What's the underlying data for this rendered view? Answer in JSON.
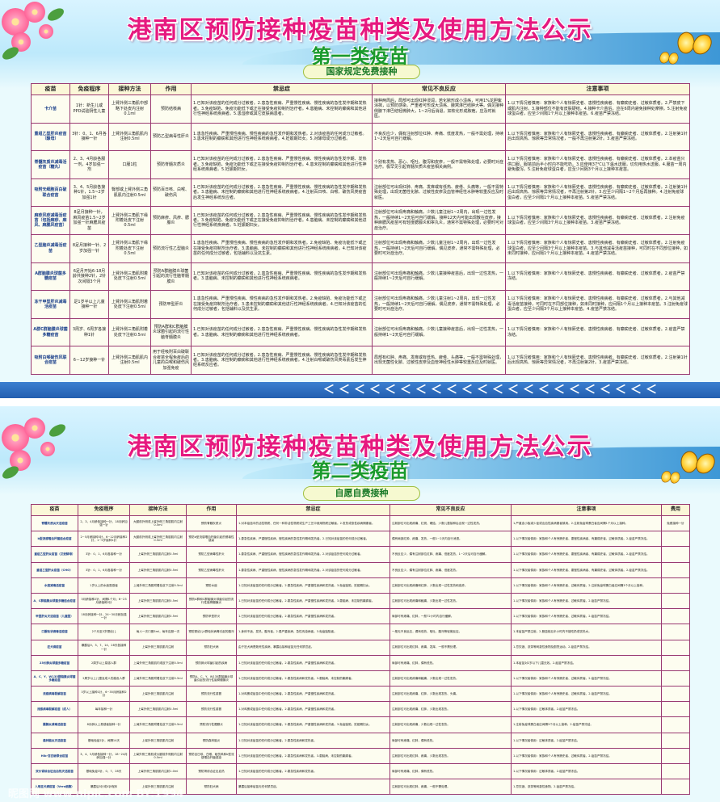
{
  "panel1": {
    "title": "港南区预防接种疫苗种类及使用方法公示",
    "subtitle": "第一类疫苗",
    "pill": "国家规定免费接种",
    "headers": [
      "疫苗",
      "免疫程序",
      "接种方法",
      "作用",
      "禁忌症",
      "常见不良反应",
      "注意事项"
    ],
    "rows": [
      [
        "卡介苗",
        "1针：新生儿或PPD试验阴性儿童",
        "上臂外侧三角肌中部略下处皮内注射0.1ml",
        "预防结核病",
        "1.已知对该疫苗的任何成分过敏者。2.患急性疾病、严重慢性疾病、慢性疾病的急性发作期和发热者。3.免疫缺陷、免疫功能低下或正在接受免疫抑制剂治疗者。4.患脑病、未控制的癫痫和其他进行性神经系统疾病者。5.患湿疹或其它皮肤病患者。",
        "接种两周后，局部可出现红肿浸润，若化脓形成小溃疡，可用1%龙胆紫涂抹，以预防感染。严重者可形成大溃疡、腋窝淋巴结肿大等。偶见接种侧腋下淋巴结轻微肿大，1~2月后消退，如软化形成脓疱，应及时就医。",
        "1.以下情况者慎用：家族和个人有惊厥史者、患慢性疾病者、有癫痫史者、过敏体质者。2.严禁皮下或肌内注射。3.接种部位不能有皮肤硬结。4.接种卡介苗后，应在6周内避免接种处摩擦。5.注射免疫球蛋白者，应至少间隔1个月以上接种本疫苗。6.疫苗严禁冻结。"
      ],
      [
        "重组乙型肝炎疫苗（酿母）",
        "3针：0、1、6月各接种一针",
        "上臂外侧三角肌肌内注射0.5ml",
        "预防乙型病毒性肝炎",
        "1.患急性疾病、严重慢性疾病、慢性疾病的急性发作期和发热者。2.对该疫苗的任何成分过敏者。3.患未控制的癫痫和其他进行性神经系统疾病者。4.妊娠期妇女。5.对酵母成分过敏者。",
        "不良反应少，偶有注射部位红肿、疼痛、低度发热，一般不需处理，持续1~2天后可自行缓解。",
        "1.以下情况者慎用：家族和个人有惊厥史者、患慢性疾病者、有癫痫史者、过敏体质者。2.注射第1针后出现高热、惊厥等异常情况者，一般不再注射第2针。3.疫苗严禁冻结。"
      ],
      [
        "脊髓灰质炎减毒活疫苗（糖丸）",
        "2、3、4月龄各服一剂，4岁加强一剂",
        "口服1粒",
        "预防脊髓灰质炎",
        "1.已知对该疫苗的任何成分过敏者。2.患急性疾病、严重慢性疾病、慢性疾病的急性发作期、发热者。3.免疫缺陷、免疫功能低下或正在接受免疫抑制剂治疗者。4.患未控制的癫痫和其他进行性神经系统疾病者。5.妊娠期妇女。",
        "个别有发热、恶心、呕吐、腹泻和皮疹，一般不需特殊处理，必要时对症治疗。极罕见引起脊髓灰质炎疫苗相关病例。",
        "1.以下情况者慎用：家族和个人有惊厥史者、患慢性疾病者、有癫痫史者、过敏体质者。2.本疫苗只供口服，服苗前后半小时内不能吃奶。3.应使用37℃以下温水送服，切勿用热水送服。4.服苗一周内避免腹泻。5.注射免疫球蛋白者，应至少间隔3个月以上接种本疫苗。"
      ],
      [
        "吸附无细胞百白破联合疫苗",
        "3、4、5月龄各接种1针，1.5~2岁加强1针",
        "臀部或上臂外侧三角肌肌内注射0.5ml",
        "预防百日咳、白喉、破伤风",
        "1.已知对该疫苗的任何成分过敏者。2.患急性疾病、严重慢性疾病、慢性疾病的急性发作期和发热者。3.患脑病、未控制的癫痫和其他进行性神经系统疾病者。4.注射百日咳、白喉、破伤风类疫苗后发生神经系统反应者。",
        "注射部位可出现红肿、疼痛、发痒或有低热、疲倦、头痛等，一般不需特殊处理，出现无菌性化脓、过敏性皮疹及血管神经性水肿等较重反应及时就医。",
        "1.以下情况者慎用：家族和个人有惊厥史者、患慢性疾病者、有癫痫史者、过敏体质者。2.注射第1针后出现高热、惊厥等异常情况者，不再注射第2针。3.应至少间隔1~2个月后再接种。4.注射免疫球蛋白者，应至少间隔1个月以上接种本疫苗。5.疫苗严禁冻结。"
      ],
      [
        "麻疹风疹减毒活疫苗（包括麻疹、麻风、麻腮风疫苗）",
        "8足月接种一针，麻风疫苗1.5~2岁加强一针麻腮风疫苗",
        "上臂外侧三角肌下缘附着处皮下注射0.5ml",
        "预防麻疹、风疹、腮腺炎",
        "1.已知对该疫苗的任何成分过敏者。2.患急性疾病、严重慢性疾病、慢性疾病的急性发作期和发热者。3.免疫缺陷、免疫功能低下或正在接受免疫抑制剂治疗者。4.患脑病、未控制的癫痫和其他进行性神经系统疾病者。5.妊娠期妇女。",
        "注射部位可出现疼痛和触痛，少数儿童注射1~2周内，出现一过性发热，一般持续1~2天后可自行缓解，接种12天内可能出现散在皮疹，接种麻腮风疫苗可有轻度腮腺炎和睾丸炎，通常不需特殊处理，必要时可对症治疗。",
        "1.以下情况者慎用：家族和个人有惊厥史者、患慢性疾病者、有癫痫史者、过敏体质者。2.注射免疫球蛋白者，应至少间隔3个月以上接种本疫苗。3.疫苗严禁冻结。"
      ],
      [
        "乙型脑炎减毒活疫苗",
        "8足月接种一针、2岁加强一针",
        "上臂外侧三角肌下缘附着处皮下注射0.5ml",
        "预防流行性乙型脑炎",
        "1.患急性疾病、严重慢性疾病、慢性疾病的急性发作期和发热者。2.免疫缺陷、免疫功能低下或正在接受免疫抑制剂治疗者。3.患脑病、未控制的癫痫和其他进行性神经系统疾病者。4.已知对该疫苗的任何成分过敏者，包括辅料以及抗生素。",
        "注射部位可出现疼痛和触痛，少数儿童注射1~2周内，出现一过性发热，一般持续1~2天后可自行缓解，偶见皮疹，通常不需特殊处理，必要时可对症治疗。",
        "1.以下情况者慎用：家族和个人有惊厥史者、患慢性疾病者、有癫痫史者、过敏体质者。2.注射免疫球蛋白者，应至少间隔3个月以上接种本疫苗。3.与其他减毒活疫苗接种，可同时在不同部位接种，如未同时接种，应间隔1个月以上接种本疫苗。4.疫苗严禁冻结。"
      ],
      [
        "A群脑膜炎球菌多糖疫苗",
        "6足月开始6-18月龄共接种2针，2针次间隔3个月",
        "上臂外侧三角肌附着处皮下注射0.5ml",
        "预防A群脑膜炎球菌引起的流行性脑脊髓膜炎",
        "1.已知对该疫苗的任何成分过敏者。2.患急性疾病、严重慢性疾病、慢性疾病的急性发作期和发热者。3.患脑病、未控制的癫痫和其他进行性神经系统疾病者。",
        "注射部位可出现疼痛和触痛，少数儿童接种疫苗后，出现一过性发热，一般持续1~2天后可自行缓解。",
        "1.以下情况者慎用：家族和个人有惊厥史者、患慢性疾病者、有癫痫史者、过敏体质者。2.疫苗严禁冻结。"
      ],
      [
        "冻干甲型肝炎减毒活疫苗",
        "足1岁半以上儿童接种一针",
        "上臂外侧三角肌附着处皮下注射0.5ml",
        "预防甲型肝炎",
        "1.患急性疾病、严重慢性疾病、慢性疾病的急性发作期和发热者。2.免疫缺陷、免疫功能低下或正在接受免疫抑制剂治疗者。3.患未控制的癫痫和其他进行性神经系统疾病者。4.已知对该疫苗的任何成分过敏者，包括辅料以及抗生素。",
        "注射部位可出现疼痛和触痛，少数儿童注射1~2周内，出现一过性发热，一般持续1~2天后可自行缓解，偶见皮疹，通常不需特殊处理，必要时可对症治疗。",
        "1.以下情况者慎用：家族和个人有惊厥史者、患慢性疾病者、有癫痫史者、过敏体质者。2.与其他减毒活疫苗接种，可同时在不同部位接种，如未同时接种，应间隔1个月以上接种本疫苗。3.注射免疫球蛋白者，应至少间隔3个月以上接种本疫苗。4.疫苗严禁冻结。"
      ],
      [
        "A群C群脑膜炎球菌多糖疫苗",
        "3周岁、6周岁各接种1针",
        "上臂外侧三角肌附着处皮下注射0.5ml",
        "预防A群和C群脑膜炎球菌引起的流行性脑脊髓膜炎",
        "1.已知对该疫苗的任何成分过敏者。2.患急性疾病、严重慢性疾病、慢性疾病的急性发作期和发热者。3.患脑病、未控制的癫痫和其他进行性神经系统疾病者。",
        "注射部位可出现疼痛和触痛，少数儿童接种疫苗后，出现一过性发热，一般持续1~2天后可自行缓解。",
        "1.以下情况者慎用：家族和个人有惊厥史者、患慢性疾病者、有癫痫史者、过敏体质者。2.疫苗严禁冻结。"
      ],
      [
        "吸附白喉破伤风联合疫苗",
        "6－12岁接种一针",
        "上臂外侧三角肌肌内注射0.5ml",
        "用于经吸附百白破联合疫苗全程免疫后的儿童的白喉和破伤风加强免疫",
        "1.已知对该疫苗的任何成分过敏者。2.患急性疾病、严重慢性疾病、慢性疾病的急性发作期和发热者。3.患脑病、未控制的癫痫和其他进行性神经系统疾病者。4.注射白喉或破伤风类毒素后发生神经系统反应者。",
        "局部有红肿、疼痛、发痒或有低热、疲倦、头痛等，一般不需特殊处理，出现无菌性化脓、过敏性皮疹及血管神经性水肿等较重反应及时就医。",
        "1.以下情况者慎用：家族和个人有惊厥史者、患慢性疾病者、有癫痫史者、过敏体质者。2.注射第1针后出现高热、惊厥等异常情况者，不再注射第2针。3.疫苗严禁冻结。"
      ]
    ]
  },
  "panel2": {
    "title": "港南区预防接种疫苗种类及使用方法公示",
    "subtitle": "第二类疫苗",
    "pill": "自愿自费接种",
    "headers": [
      "疫苗",
      "免疫程序",
      "接种方法",
      "作用",
      "禁忌症",
      "常见不良反应",
      "注意事项",
      "费用"
    ],
    "rows": [
      [
        "脊髓灰质炎灭活疫苗",
        "2、3、4月龄各接种一针，18月龄加强一针",
        "大腿前外侧或上臂外侧三角肌肌内注射0.5ml",
        "预防脊髓灰质炎",
        "1.对本疫苗中的活性物质、任何一种非活性物质或生产工艺中使用物质过敏者。2.发热或急性疾病期患者。",
        "注射部位可出现疼痛、红斑、硬结，少数儿童接种后出现一过性发热。",
        "1.严重血小板减少症或出血性疾病患者慎用。2.注射免疫球蛋白者应间隔1个月以上接种。",
        "免费接种一针"
      ],
      [
        "b型流感嗜血杆菌结合疫苗",
        "2~5月龄接种3针，6~12月龄接种2针，1~5岁接种1针",
        "大腿前外侧或上臂外侧三角肌肌内注射0.5ml",
        "预防b型流感嗜血杆菌引起的侵袭性感染",
        "1.患急性疾病、严重慢性疾病、慢性疾病的急性发作期和发热者。2.已知对该疫苗的任何成分过敏者。",
        "偶有局部红肿、疼痛、发热，一般1~2天内自行消退。",
        "1.以下情况者慎用：家族和个人有惊厥史者、患慢性疾病者、有癫痫史者、过敏体质者。2.疫苗严禁冻结。",
        ""
      ],
      [
        "重组乙型肝炎疫苗（汉逊酵母）",
        "3针：0、1、6月各接种一针",
        "上臂外侧三角肌肌内注射0.5ml",
        "预防乙型病毒性肝炎",
        "1.患急性疾病、严重慢性疾病、慢性疾病的急性发作期和发热者。2.对该疫苗的任何成分过敏者。",
        "不良反应少，偶有注射部位红肿、疼痛、低度发热，1~2天后可自行缓解。",
        "1.以下情况者慎用：家族和个人有惊厥史者、患慢性疾病者、有癫痫史者、过敏体质者。2.疫苗严禁冻结。",
        ""
      ],
      [
        "重组乙型肝炎疫苗（CHO）",
        "3针：0、1、6月各接种一针",
        "上臂外侧三角肌肌内注射0.5ml",
        "预防乙型病毒性肝炎",
        "1.患急性疾病、严重慢性疾病、慢性疾病的急性发作期和发热者。2.对该疫苗的任何成分过敏者。",
        "不良反应少，偶有注射部位红肿、疼痛、低度发热。",
        "1.以下情况者慎用：家族和个人有惊厥史者、患慢性疾病者、有癫痫史者、过敏体质者。2.疫苗严禁冻结。",
        ""
      ],
      [
        "水痘减毒活疫苗",
        "1岁以上的水痘易感者",
        "上臂外侧三角肌附着处皮下注射0.5ml",
        "预防水痘",
        "1.已知对该疫苗的任何成分过敏者。2.患急性疾病、严重慢性疾病和发热者。3.免疫缺陷、妊娠期妇女。",
        "注射部位可出现疼痛和红肿，少数出现一过性发热和皮疹。",
        "1.以下情况者慎用：家族和个人有惊厥史者、过敏体质者。2.注射免疫球蛋白者应间隔3个月以上接种。",
        ""
      ],
      [
        "A、C群脑膜炎球菌多糖结合疫苗",
        "3月龄接种2针，间隔1个月；6~23月龄接种2针",
        "上臂外侧三角肌肌内注射0.5ml",
        "预防A群和C群脑膜炎球菌引起的流行性脑脊髓膜炎",
        "1.已知对该疫苗的任何成分过敏者。2.患急性疾病、严重慢性疾病和发热者。3.患脑病、未控制的癫痫者。",
        "注射部位可出现疼痛和触痛，少数出现一过性发热。",
        "1.以下情况者慎用：家族和个人有惊厥史者、过敏体质者。2.疫苗严禁冻结。",
        ""
      ],
      [
        "甲型肝炎灭活疫苗（儿童型）",
        "18月龄接种一针，24~30月龄加强一针",
        "上臂外侧三角肌肌内注射0.5ml",
        "预防甲型肝炎",
        "1.已知对该疫苗的任何成分过敏者。2.患急性疾病、严重慢性疾病和发热者。",
        "局部可有疼痛、红肿，一般72小时内自行缓解。",
        "1.以下情况者慎用：家族和个人有惊厥史者、过敏体质者。2.疫苗严禁冻结。",
        ""
      ],
      [
        "口服轮状病毒活疫苗",
        "2个月至3岁婴幼儿",
        "每人一次口服3ml，每年应服一次",
        "预防婴幼儿A群轮状病毒引起的腹泻",
        "1.身体不适、发热、腹泻者。2.患严重疾病、急性传染病者。3.免疫缺陷者。",
        "一般无不良反应，偶有低热、呕吐、腹泻等轻微反应。",
        "1.本疫苗严禁注射。2.服苗前后半小时内不能吃奶或饮热水。",
        ""
      ],
      [
        "狂犬病疫苗",
        "暴露后0、3、7、14、28天各接种一针",
        "上臂外侧三角肌肌内注射",
        "预防狂犬病",
        "由于狂犬病是致死性疾病，暴露后接种疫苗无任何禁忌症。",
        "注射部位可出现红肿、疼痛、发痒，一般不需处理。",
        "1.忌饮酒、浓茶等刺激性食物及剧烈运动。2.疫苗严禁冻结。",
        ""
      ],
      [
        "23价肺炎球菌多糖疫苗",
        "2周岁以上易感人群",
        "上臂外侧三角肌肌内或皮下注射0.5ml",
        "预防肺炎球菌引起的疾病",
        "1.已知对该疫苗的任何成分过敏者。2.患急性疾病、严重慢性疾病和发热者。",
        "局部可有疼痛、红肿，偶有低热。",
        "1.本疫苗对2岁以下儿童无效。2.疫苗严禁冻结。",
        ""
      ],
      [
        "A、C、Y、W135群脑膜炎球菌多糖疫苗",
        "2周岁以上儿童及成人的高危人群",
        "上臂外侧三角肌附着处皮下注射0.5ml",
        "预防A、C、Y、W135群脑膜炎球菌引起的流行性脑脊髓膜炎",
        "1.已知对该疫苗的任何成分过敏者。2.患急性疾病和发热者。3.患脑病、未控制的癫痫者。",
        "注射部位可出现疼痛和触痛，少数出现一过性发热。",
        "1.以下情况者慎用：家族和个人有惊厥史者、过敏体质者。2.疫苗严禁冻结。",
        ""
      ],
      [
        "流感病毒裂解疫苗",
        "3岁以上接种1针，6~35月龄接种2针",
        "上臂外侧三角肌肌内注射",
        "预防流行性感冒",
        "1.对鸡蛋或疫苗中任何成分过敏者。2.患急性疾病、严重慢性疾病和发热者。",
        "注射部位可出现疼痛、红肿，少数出现发热、头痛。",
        "1.以下情况者慎用：家族和个人有惊厥史者、过敏体质者。2.疫苗严禁冻结。",
        ""
      ],
      [
        "流感病毒裂解疫苗（成人）",
        "每年接种一针",
        "上臂外侧三角肌肌内注射0.5ml",
        "预防流行性感冒",
        "1.对鸡蛋或疫苗中任何成分过敏者。2.患急性疾病、严重慢性疾病和发热者。",
        "注射部位可出现疼痛、红肿，少数出现发热。",
        "1.以下情况者慎用：过敏体质者。2.疫苗严禁冻结。",
        ""
      ],
      [
        "腮腺炎减毒活疫苗",
        "8月龄以上易感者接种一针",
        "上臂外侧三角肌附着处皮下注射0.5ml",
        "预防流行性腮腺炎",
        "1.已知对该疫苗的任何成分过敏者。2.患急性疾病、严重慢性疾病和发热者。3.免疫缺陷、妊娠期妇女。",
        "注射部位可出现疼痛，少数出现一过性发热。",
        "1.注射免疫球蛋白者应间隔3个月以上接种。2.疫苗严禁冻结。",
        ""
      ],
      [
        "森林脑炎灭活疫苗",
        "基础免疫2针，间隔14天",
        "上臂外侧三角肌肌内注射",
        "预防森林脑炎",
        "1.已知对该疫苗的任何成分过敏者。2.患急性疾病和发热者。",
        "局部可有疼痛、红肿，偶有低热。",
        "1.以下情况者慎用：过敏体质者。2.疫苗严禁冻结。",
        ""
      ],
      [
        "Hib-百白破联合疫苗",
        "3、4、5月龄各接种一针，18~24月龄加强一针",
        "上臂外侧三角肌或大腿前外侧肌内注射0.5ml",
        "预防百日咳、白喉、破伤风和b型流感嗜血杆菌感染",
        "1.已知对该疫苗的任何成分过敏者。2.患急性疾病和发热者。3.患脑病、未控制的癫痫者。",
        "注射部位可出现红肿、疼痛，少数出现发热。",
        "1.以下情况者慎用：家族和个人有惊厥史者、过敏体质者。2.疫苗严禁冻结。",
        ""
      ],
      [
        "双价肾综合征出血热灭活疫苗",
        "基础免疫3针，0、7、28天",
        "上臂外侧三角肌肌内注射1.0ml",
        "预防肾综合征出血热",
        "1.已知对该疫苗的任何成分过敏者。2.患急性疾病和发热者。",
        "局部可有疼痛、红肿，偶有低热。",
        "1.以下情况者慎用：过敏体质者。2.疫苗严禁冻结。",
        ""
      ],
      [
        "人用狂犬病疫苗（Vero细胞）",
        "暴露后5针或4针程序",
        "上臂外侧三角肌肌内注射",
        "预防狂犬病",
        "暴露后接种疫苗无任何禁忌症。",
        "注射部位可出现红肿、疼痛，一般不需处理。",
        "1.忌饮酒、浓茶等刺激性食物。2.疫苗严禁冻结。",
        ""
      ]
    ],
    "watermark": "昵图网 www.nipic.com   BY:1994"
  },
  "colors": {
    "title": "#e6197f",
    "subtitle": "#1a9a2c",
    "border": "#9a3a72",
    "strip": "#245fb0"
  },
  "arrows": "＜＜＜＜＜＜＜＜＜＜＜＜＜＜＜＜＜＜＜＜＜＜"
}
